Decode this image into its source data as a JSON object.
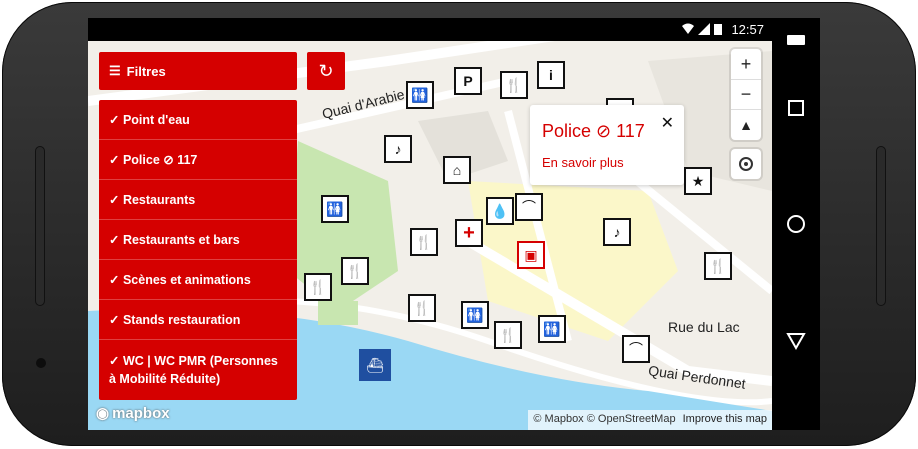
{
  "status": {
    "time": "12:57"
  },
  "filters": {
    "button_label": "Filtres",
    "items": [
      {
        "label": "✓ Point d'eau"
      },
      {
        "label": "✓ Police ⊘ 117"
      },
      {
        "label": "✓ Restaurants"
      },
      {
        "label": "✓ Restaurants et bars"
      },
      {
        "label": "✓ Scènes et animations"
      },
      {
        "label": "✓ Stands restauration"
      },
      {
        "label": "✓ WC | WC PMR (Personnes à Mobilité Réduite)"
      }
    ]
  },
  "popup": {
    "title": "Police ⊘ 117",
    "link": "En savoir plus",
    "close": "✕"
  },
  "map": {
    "streets": [
      "Quai d'Arabie",
      "Rue du Lac",
      "Quai Perdonnet"
    ],
    "attribution": "© Mapbox © OpenStreetMap",
    "improve": "Improve this map",
    "logo": "mapbox"
  },
  "controls": {
    "zoom_in": "+",
    "zoom_out": "−",
    "compass": "▲"
  }
}
